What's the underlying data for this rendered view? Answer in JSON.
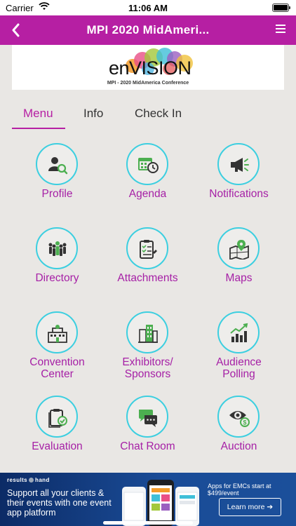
{
  "status_bar": {
    "carrier": "Carrier",
    "time": "11:06 AM"
  },
  "nav": {
    "title": "MPI 2020 MidAmeri...",
    "back_icon": "chevron-left-icon",
    "menu_icon": "hamburger-menu-icon"
  },
  "banner": {
    "logo_text": "enVISION",
    "subtitle": "MPI - 2020 MidAmerica Conference"
  },
  "tabs": [
    {
      "label": "Menu",
      "active": true
    },
    {
      "label": "Info",
      "active": false
    },
    {
      "label": "Check In",
      "active": false
    }
  ],
  "menu_items": [
    {
      "label": "Profile",
      "icon": "profile-search-icon"
    },
    {
      "label": "Agenda",
      "icon": "calendar-clock-icon"
    },
    {
      "label": "Notifications",
      "icon": "megaphone-icon"
    },
    {
      "label": "Directory",
      "icon": "people-group-icon"
    },
    {
      "label": "Attachments",
      "icon": "clipboard-checklist-icon"
    },
    {
      "label": "Maps",
      "icon": "map-pin-icon"
    },
    {
      "label": "Convention\nCenter",
      "icon": "building-icon"
    },
    {
      "label": "Exhibitors/\nSponsors",
      "icon": "office-buildings-icon"
    },
    {
      "label": "Audience\nPolling",
      "icon": "bar-chart-trend-icon"
    },
    {
      "label": "Evaluation",
      "icon": "clipboard-check-icon"
    },
    {
      "label": "Chat Room",
      "icon": "chat-bubbles-icon"
    },
    {
      "label": "Auction",
      "icon": "eye-dollar-icon"
    }
  ],
  "ad": {
    "brand_left": "results",
    "brand_right": "hand",
    "headline": "Support all your clients & their events with one event app platform",
    "price": "Apps for EMCs start at $499/event",
    "cta": "Learn more ➔"
  },
  "colors": {
    "accent": "#b61fa3",
    "icon_ring": "#3ccfe0",
    "label": "#a620a6"
  }
}
